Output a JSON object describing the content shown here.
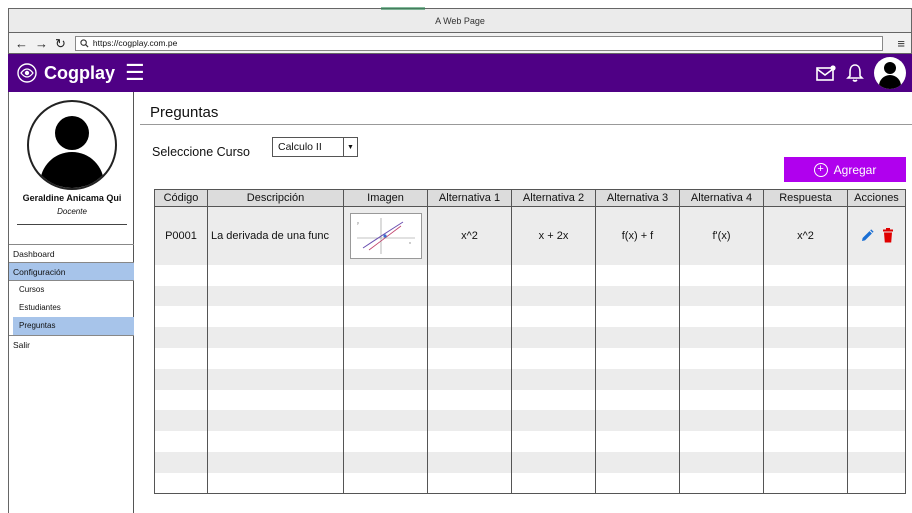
{
  "browser": {
    "window_title": "A Web Page",
    "url": "https://cogplay.com.pe"
  },
  "app": {
    "brand": "Cogplay"
  },
  "user": {
    "name": "Geraldine Anicama Qui",
    "role": "Docente"
  },
  "sidebar": {
    "items": [
      {
        "label": "Dashboard"
      },
      {
        "label": "Configuración"
      },
      {
        "label": "Cursos"
      },
      {
        "label": "Estudiantes"
      },
      {
        "label": "Preguntas"
      },
      {
        "label": "Salir"
      }
    ]
  },
  "main": {
    "title": "Preguntas",
    "course_label": "Seleccione Curso",
    "course_value": "Calculo II",
    "add_label": "Agregar"
  },
  "table": {
    "headers": [
      "Código",
      "Descripción",
      "Imagen",
      "Alternativa 1",
      "Alternativa 2",
      "Alternativa 3",
      "Alternativa 4",
      "Respuesta",
      "Acciones"
    ],
    "rows": [
      {
        "codigo": "P0001",
        "descripcion": "La derivada de una func",
        "alt1": "x^2",
        "alt2": "x + 2x",
        "alt3": "f(x) + f",
        "alt4": "f'(x)",
        "respuesta": "x^2"
      }
    ]
  },
  "colors": {
    "header_bg": "#4f0085",
    "accent_button": "#b000ee",
    "selected_menu": "#a7c4ea",
    "edit_icon": "#1a6fd4",
    "delete_icon": "#e00000"
  },
  "icons": [
    "search-icon",
    "back-arrow-icon",
    "forward-arrow-icon",
    "reload-icon",
    "menu-icon",
    "logo-icon",
    "hamburger-icon",
    "mail-icon",
    "bell-icon",
    "avatar",
    "dropdown-caret-icon",
    "plus-circle-icon",
    "edit-icon",
    "trash-icon"
  ]
}
